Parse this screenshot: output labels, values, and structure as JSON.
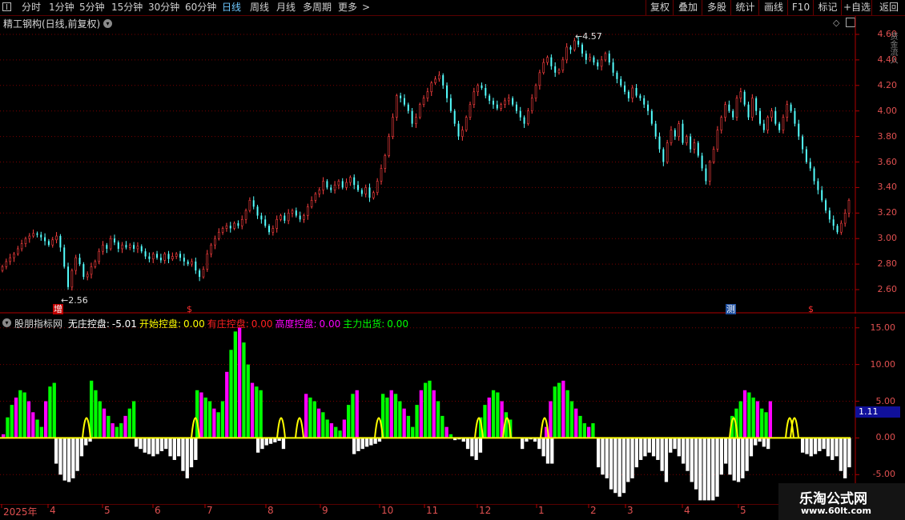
{
  "toolbar": {
    "periods": [
      {
        "label": "分时",
        "active": false
      },
      {
        "label": "1分钟",
        "active": false
      },
      {
        "label": "5分钟",
        "active": false
      },
      {
        "label": "15分钟",
        "active": false
      },
      {
        "label": "30分钟",
        "active": false
      },
      {
        "label": "60分钟",
        "active": false
      },
      {
        "label": "日线",
        "active": true
      },
      {
        "label": "周线",
        "active": false
      },
      {
        "label": "月线",
        "active": false
      },
      {
        "label": "多周期",
        "active": false
      },
      {
        "label": "更多",
        "active": false
      }
    ],
    "more_arrow": ">",
    "right_buttons": [
      "复权",
      "叠加",
      "多股",
      "统计",
      "画线",
      "F10",
      "标记",
      "+自选",
      "返回"
    ]
  },
  "main_chart": {
    "title": "精工钢构(日线,前复权)",
    "high_marker": "4.57",
    "low_marker": "2.56",
    "price_ticks": [
      "4.60",
      "4.40",
      "4.20",
      "4.00",
      "3.80",
      "3.60",
      "3.40",
      "3.20",
      "3.00",
      "2.80",
      "2.60"
    ],
    "markers": [
      {
        "text": "增",
        "color": "#ffffff",
        "bg": "#c00000"
      },
      {
        "text": "$",
        "color": "#ff3030",
        "bg": ""
      },
      {
        "text": "测",
        "color": "#ffffff",
        "bg": "#2050a0"
      },
      {
        "text": "$",
        "color": "#ff3030",
        "bg": ""
      }
    ],
    "side_text": "资金流入"
  },
  "indicator": {
    "name": "股朋指标网",
    "items": [
      {
        "label": "无庄控盘:",
        "value": "-5.01",
        "color": "#ffffff"
      },
      {
        "label": "开始控盘:",
        "value": "0.00",
        "color": "#ffff00"
      },
      {
        "label": "有庄控盘:",
        "value": "0.00",
        "color": "#ff2020"
      },
      {
        "label": "高度控盘:",
        "value": "0.00",
        "color": "#ff00ff"
      },
      {
        "label": "主力出货:",
        "value": "0.00",
        "color": "#00ff00"
      }
    ],
    "ticks": [
      "15.00",
      "10.00",
      "5.00",
      "0.00",
      "-5.00"
    ],
    "current_value": "1.11"
  },
  "time_axis": {
    "labels": [
      "2025年",
      "4",
      "5",
      "6",
      "7",
      "8",
      "9",
      "10",
      "11",
      "12",
      "1",
      "2",
      "3",
      "4",
      "5"
    ]
  },
  "watermark": {
    "title": "乐淘公式网",
    "url": "www.60lt.com"
  },
  "colors": {
    "up": "#ff4040",
    "down": "#54ffff",
    "grid": "#7a0000",
    "axis": "#b00000",
    "white_bar": "#ffffff",
    "yellow": "#ffff00",
    "magenta": "#ff00ff",
    "green": "#00ff00"
  },
  "chart_data": [
    {
      "type": "candlestick",
      "title": "精工钢构(日线,前复权)",
      "ylim": [
        2.55,
        4.65
      ],
      "x_labels": [
        "2025年",
        "4",
        "5",
        "6",
        "7",
        "8",
        "9",
        "10",
        "11",
        "12",
        "1",
        "2",
        "3",
        "4",
        "5"
      ],
      "close": [
        2.78,
        2.82,
        2.85,
        2.88,
        2.92,
        2.96,
        3.0,
        3.02,
        3.04,
        3.03,
        3.01,
        2.98,
        2.95,
        2.99,
        3.02,
        2.93,
        2.78,
        2.62,
        2.75,
        2.85,
        2.8,
        2.7,
        2.72,
        2.78,
        2.82,
        2.9,
        2.95,
        2.92,
        3.0,
        2.97,
        2.92,
        2.95,
        2.93,
        2.95,
        2.92,
        2.94,
        2.9,
        2.86,
        2.84,
        2.88,
        2.85,
        2.83,
        2.88,
        2.84,
        2.86,
        2.88,
        2.85,
        2.82,
        2.8,
        2.82,
        2.75,
        2.7,
        2.76,
        2.88,
        2.95,
        3.0,
        3.05,
        3.08,
        3.1,
        3.08,
        3.12,
        3.1,
        3.15,
        3.22,
        3.3,
        3.25,
        3.18,
        3.15,
        3.1,
        3.05,
        3.08,
        3.15,
        3.18,
        3.14,
        3.2,
        3.22,
        3.18,
        3.15,
        3.18,
        3.25,
        3.3,
        3.35,
        3.38,
        3.45,
        3.4,
        3.38,
        3.42,
        3.45,
        3.4,
        3.44,
        3.48,
        3.42,
        3.38,
        3.35,
        3.4,
        3.32,
        3.36,
        3.45,
        3.55,
        3.65,
        3.8,
        3.95,
        4.12,
        4.1,
        4.05,
        4.0,
        3.9,
        3.95,
        4.05,
        4.1,
        4.15,
        4.22,
        4.25,
        4.28,
        4.2,
        4.1,
        4.0,
        3.9,
        3.8,
        3.85,
        3.95,
        4.05,
        4.15,
        4.2,
        4.18,
        4.12,
        4.08,
        4.05,
        4.02,
        4.05,
        4.08,
        4.1,
        4.05,
        4.0,
        3.95,
        3.9,
        4.0,
        4.1,
        4.2,
        4.3,
        4.38,
        4.42,
        4.35,
        4.3,
        4.32,
        4.4,
        4.5,
        4.48,
        4.55,
        4.52,
        4.45,
        4.4,
        4.42,
        4.38,
        4.35,
        4.4,
        4.45,
        4.38,
        4.3,
        4.25,
        4.2,
        4.15,
        4.1,
        4.18,
        4.12,
        4.1,
        4.05,
        4.0,
        3.9,
        3.8,
        3.7,
        3.6,
        3.75,
        3.85,
        3.8,
        3.9,
        3.75,
        3.8,
        3.7,
        3.75,
        3.65,
        3.55,
        3.45,
        3.6,
        3.7,
        3.85,
        3.95,
        4.05,
        4.0,
        3.95,
        4.1,
        4.15,
        4.05,
        3.95,
        4.1,
        4.0,
        3.9,
        3.85,
        3.95,
        4.0,
        3.9,
        3.85,
        3.95,
        4.05,
        4.0,
        3.9,
        3.8,
        3.7,
        3.6,
        3.55,
        3.45,
        3.38,
        3.3,
        3.22,
        3.15,
        3.1,
        3.05,
        3.12,
        3.2,
        3.3
      ],
      "high": 4.57,
      "low": 2.56
    },
    {
      "type": "bar",
      "title": "股朋指标网",
      "ylim": [
        -9,
        16.5
      ],
      "series": [
        {
          "name": "无庄控盘",
          "values": [
            -3.5,
            -5.0,
            -5.8,
            -6.0,
            -5.5,
            -4.5,
            -2.5,
            -1.0,
            -0.5,
            -1.2,
            -1.5,
            -2.0,
            -2.2,
            -2.5,
            -2.2,
            -1.8,
            -1.5,
            -2.5,
            -3.0,
            -2.5,
            -4.5,
            -5.5,
            -4.0,
            -3.0,
            -2.0,
            -1.5,
            -1.0,
            -0.8,
            -0.6,
            -0.4,
            -1.5,
            -2.2,
            -1.8,
            -1.5,
            -1.2,
            -1.0,
            -0.8,
            -0.5,
            -0.3,
            -0.2,
            -0.5,
            -1.5,
            -2.5,
            -3.0,
            -2.0,
            -1.5,
            -0.5,
            -0.2,
            -0.5,
            -1.5,
            -2.5,
            -3.5,
            -3.5,
            -4.0,
            -5.0,
            -5.5,
            -7.0,
            -7.5,
            -8.0,
            -7.5,
            -6.0,
            -5.5,
            -4.0,
            -3.0,
            -2.5,
            -2.0,
            -2.5,
            -3.0,
            -4.5,
            -6.0,
            -2.0,
            -1.5,
            -2.5,
            -3.5,
            -4.5,
            -6.0,
            -7.0,
            -8.5,
            -8.5,
            -8.5,
            -8.5,
            -8.0,
            -5.0
          ]
        },
        {
          "name": "开始控盘",
          "values": [
            0.0
          ]
        },
        {
          "name": "有庄控盘",
          "values": [
            0.0
          ]
        },
        {
          "name": "高度控盘",
          "values": [
            0.5,
            2.8,
            4.5,
            5.5,
            6.5,
            6.2,
            5.0,
            3.5,
            2.5,
            1.5,
            5.0,
            7.0,
            7.5,
            7.8,
            6.5,
            5.0,
            4.0,
            3.0,
            2.0,
            1.5,
            2.0,
            3.0,
            4.0,
            5.0,
            6.5,
            6.2,
            5.5,
            5.0,
            4.0,
            3.5,
            5.0,
            9.0,
            12.0,
            14.5,
            15.0,
            13.0,
            10.0,
            7.5,
            7.0,
            6.5,
            6.0,
            5.5,
            5.0,
            4.0,
            3.5,
            2.5,
            2.0,
            1.5,
            1.0,
            2.5,
            4.5,
            6.0,
            6.5,
            6.0,
            5.5,
            6.5,
            6.0,
            5.0,
            4.0,
            3.0,
            1.5,
            4.5,
            6.5,
            7.5,
            7.8,
            6.5,
            5.0,
            3.0,
            1.5
          ]
        },
        {
          "name": "主力出货",
          "values": [
            0.0
          ]
        }
      ]
    }
  ]
}
